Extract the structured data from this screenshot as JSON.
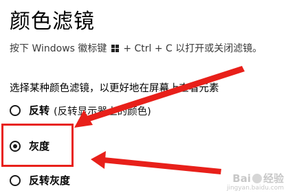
{
  "page": {
    "title": "颜色滤镜",
    "hint_before_icon": "按下 Windows 徽标键",
    "hint_after_icon": "+ Ctrl + C 以打开或关闭滤镜。",
    "section_label": "选择某种颜色滤镜，以更好地在屏幕上查看元素"
  },
  "filters": [
    {
      "label": "反转",
      "desc": "(反转显示器上的颜色)",
      "checked": false
    },
    {
      "label": "灰度",
      "desc": "",
      "checked": true
    },
    {
      "label": "反转灰度",
      "desc": "",
      "checked": false
    }
  ],
  "annotations": {
    "highlight_color": "#e8201a",
    "arrow_color": "#e8201a"
  },
  "watermark": {
    "brand_left": "Bai",
    "brand_right": "经验",
    "url": "jingyan.baidu.com"
  },
  "icons": {
    "windows_logo": "windows-logo-icon",
    "paw": "baidu-paw-icon"
  }
}
